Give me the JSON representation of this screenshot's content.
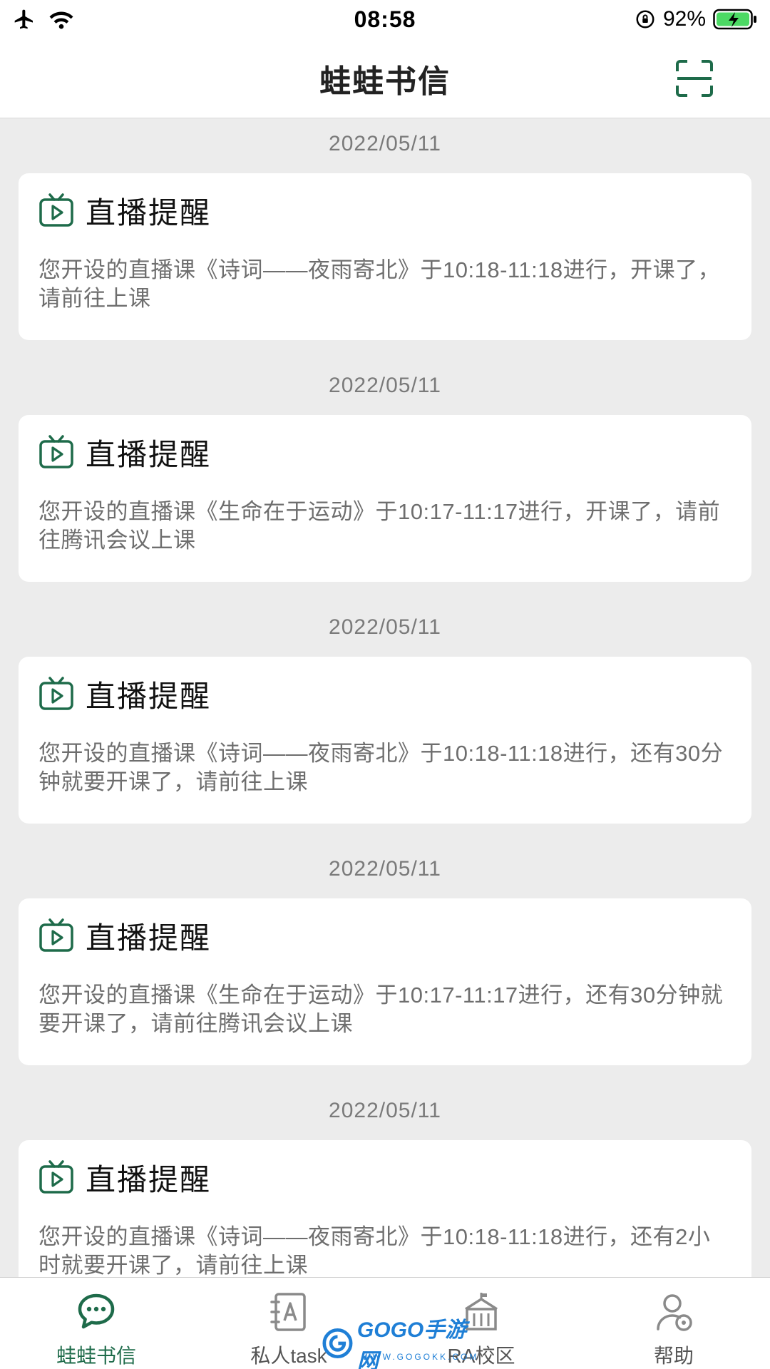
{
  "status_bar": {
    "time": "08:58",
    "battery_percent": "92%",
    "icons": [
      "airplane-icon",
      "wifi-icon",
      "orientation-lock-icon",
      "battery-charging-icon"
    ]
  },
  "header": {
    "title": "蛙蛙书信",
    "right_icon": "scan-icon"
  },
  "messages": [
    {
      "date": "2022/05/11",
      "title": "直播提醒",
      "body": "您开设的直播课《诗词——夜雨寄北》于10:18-11:18进行，开课了，请前往上课"
    },
    {
      "date": "2022/05/11",
      "title": "直播提醒",
      "body": "您开设的直播课《生命在于运动》于10:17-11:17进行，开课了，请前往腾讯会议上课"
    },
    {
      "date": "2022/05/11",
      "title": "直播提醒",
      "body": "您开设的直播课《诗词——夜雨寄北》于10:18-11:18进行，还有30分钟就要开课了，请前往上课"
    },
    {
      "date": "2022/05/11",
      "title": "直播提醒",
      "body": "您开设的直播课《生命在于运动》于10:17-11:17进行，还有30分钟就要开课了，请前往腾讯会议上课"
    },
    {
      "date": "2022/05/11",
      "title": "直播提醒",
      "body": "您开设的直播课《诗词——夜雨寄北》于10:18-11:18进行，还有2小时就要开课了，请前往上课"
    }
  ],
  "tabs": [
    {
      "label": "蛙蛙书信",
      "icon": "chat-bubbles-icon",
      "active": true
    },
    {
      "label": "私人task",
      "icon": "notebook-icon",
      "active": false
    },
    {
      "label": "RA校区",
      "icon": "school-building-icon",
      "active": false
    },
    {
      "label": "帮助",
      "icon": "user-help-icon",
      "active": false
    }
  ],
  "watermark": {
    "text": "GOGO手游网",
    "sub": "WWW.GOGOKK.COM"
  },
  "colors": {
    "accent": "#1e6b4a",
    "background": "#ececec",
    "card": "#ffffff",
    "muted_text": "#6e6e6e",
    "battery": "#4cd964"
  }
}
